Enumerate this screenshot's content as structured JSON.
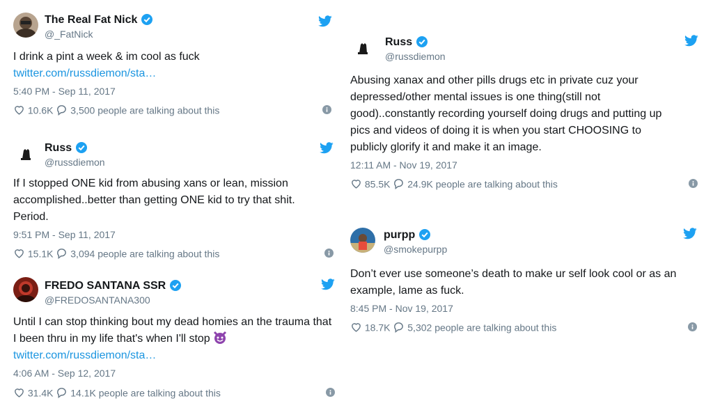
{
  "tweets": [
    {
      "name": "The Real Fat Nick",
      "handle": "@_FatNick",
      "text": "I drink a pint a week & im cool as fuck",
      "link": "twitter.com/russdiemon/sta…",
      "time": "5:40 PM - Sep 11, 2017",
      "likes": "10.6K",
      "talking": "3,500 people are talking about this"
    },
    {
      "name": "Russ",
      "handle": "@russdiemon",
      "text": "If I stopped ONE kid from abusing xans or lean, mission accomplished..better than getting ONE kid to try that shit. Period.",
      "time": "9:51 PM - Sep 11, 2017",
      "likes": "15.1K",
      "talking": "3,094 people are talking about this"
    },
    {
      "name": "FREDO SANTANA SSR",
      "handle": "@FREDOSANTANA300",
      "text": "Until I can stop thinking bout my dead homies an the trauma that I been thru in my life that's when I'll stop",
      "emoji": "smiling-imp-emoji",
      "link": "twitter.com/russdiemon/sta…",
      "time": "4:06 AM - Sep 12, 2017",
      "likes": "31.4K",
      "talking": "14.1K people are talking about this"
    },
    {
      "name": "Russ",
      "handle": "@russdiemon",
      "text": "Abusing xanax and other pills drugs etc in private cuz your depressed/other mental issues is one thing(still not good)..constantly recording yourself doing drugs and putting up pics and videos of doing it is when you start CHOOSING to publicly glorify it and make it an image.",
      "time": "12:11 AM - Nov 19, 2017",
      "likes": "85.5K",
      "talking": "24.9K people are talking about this"
    },
    {
      "name": "purpp",
      "handle": "@smokepurpp",
      "text": "Don’t ever use someone’s death to make ur self look cool or as an example, lame as fuck.",
      "time": "8:45 PM - Nov 19, 2017",
      "likes": "18.7K",
      "talking": "5,302 people are talking about this"
    }
  ],
  "colors": {
    "verified": "#1da1f2",
    "link": "#1b95e0",
    "muted": "#657786",
    "twitter_blue": "#1da1f2"
  },
  "icons": [
    "verified-badge-icon",
    "twitter-bird-icon",
    "heart-icon",
    "reply-bubble-icon",
    "info-icon"
  ]
}
